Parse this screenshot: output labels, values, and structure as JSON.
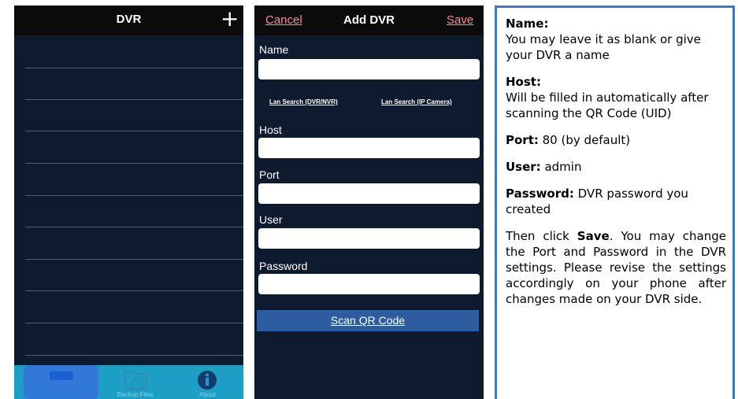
{
  "dvr_list": {
    "title": "DVR",
    "add_icon": "+",
    "tabs": [
      {
        "label": "",
        "icon": "list-icon",
        "selected": true
      },
      {
        "label": "Backup Files",
        "icon": "backup-files-icon"
      },
      {
        "label": "About",
        "icon": "info-icon"
      }
    ]
  },
  "add_dvr": {
    "cancel": "Cancel",
    "title": "Add DVR",
    "save": "Save",
    "name_label": "Name",
    "lan_search_dvr": "Lan Search (DVR/NVR)",
    "lan_search_ipcam": "Lan Search (IP Camera)",
    "host_label": "Host",
    "port_label": "Port",
    "user_label": "User",
    "password_label": "Password",
    "scan_qr": "Scan QR Code"
  },
  "instructions": {
    "name_heading": "Name:",
    "name_text": "You may leave it as blank or give your DVR a name",
    "host_heading": "Host:",
    "host_text": "Will be filled in automatically after scanning the QR Code (UID)",
    "port_heading": "Port:",
    "port_text": " 80 (by default)",
    "user_heading": "User:",
    "user_text": " admin",
    "password_heading": "Password:",
    "password_text": " DVR password you created",
    "then_click": "Then click ",
    "save_word": "Save",
    "then_rest": ". You may change the Port and Password in the DVR settings. Please revise the settings accordingly on your phone after changes made on your DVR side."
  },
  "colors": {
    "panel_bg": "#0e1b2e",
    "header_bg": "#0b0b0b",
    "link_pink": "#ff8a9a",
    "tabbar": "#1d9ec5",
    "scan_button": "#2e5ca0",
    "border_blue": "#3c7ac2"
  }
}
